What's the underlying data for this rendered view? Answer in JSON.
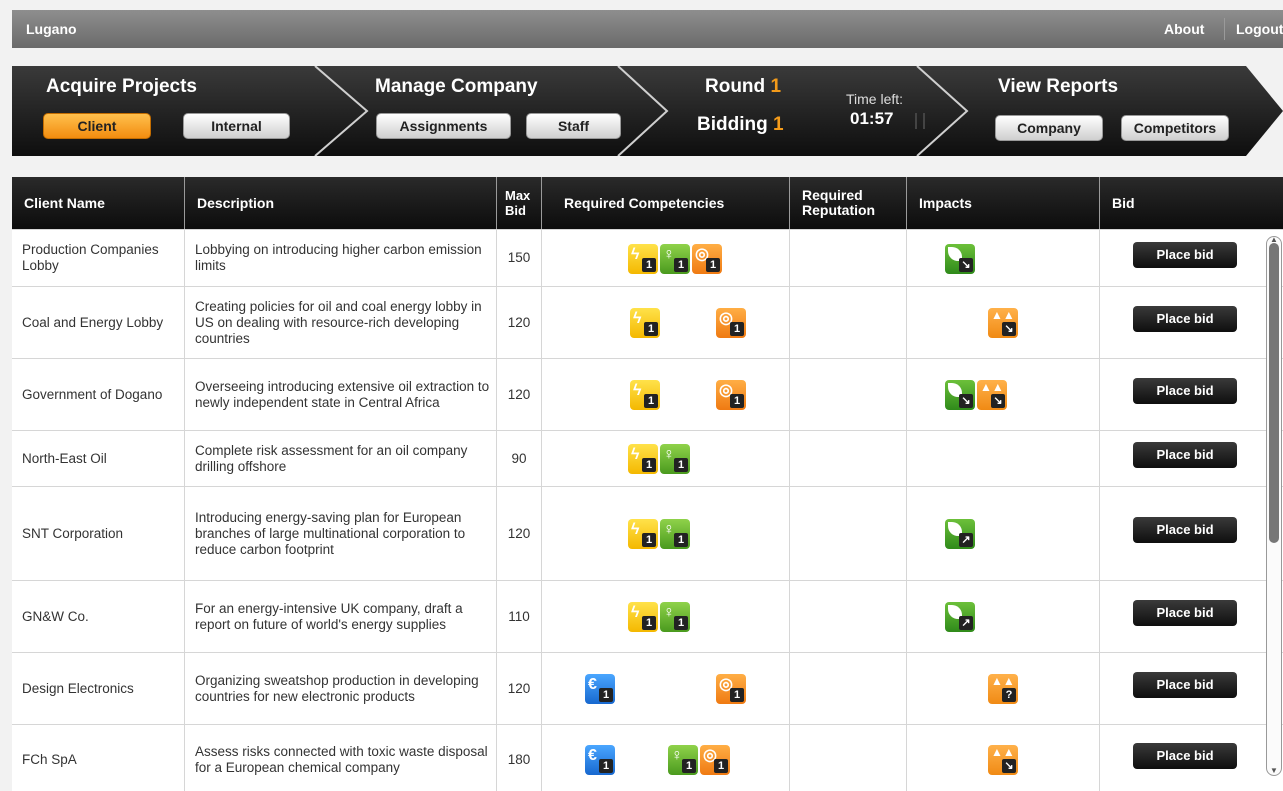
{
  "topbar": {
    "app_title": "Lugano",
    "about": "About",
    "logout": "Logout"
  },
  "nav": {
    "acquire_projects": {
      "title": "Acquire Projects",
      "client": "Client",
      "internal": "Internal"
    },
    "manage_company": {
      "title": "Manage Company",
      "assignments": "Assignments",
      "staff": "Staff"
    },
    "round": {
      "label": "Round",
      "value": "1"
    },
    "bidding": {
      "label": "Bidding",
      "value": "1"
    },
    "timer": {
      "label": "Time left:",
      "value": "01:57"
    },
    "view_reports": {
      "title": "View Reports",
      "company": "Company",
      "competitors": "Competitors"
    },
    "colors": {
      "accent": "#f49b1a",
      "active_button": "#f7a234"
    }
  },
  "table": {
    "headers": {
      "client_name": "Client Name",
      "description": "Description",
      "max_bid": [
        "Max",
        "Bid"
      ],
      "required_competencies": "Required Competencies",
      "required_reputation": [
        "Required",
        "Reputation"
      ],
      "impacts": "Impacts",
      "bid": "Bid"
    },
    "bid_label": "Place bid",
    "rows": [
      {
        "name": "Production Companies Lobby",
        "description": "Lobbying on introducing higher carbon emission limits",
        "max_bid": "150",
        "competencies": [
          {
            "type": "energy-icon",
            "level": "1"
          },
          {
            "type": "idea-icon",
            "level": "1"
          },
          {
            "type": "speech-icon",
            "level": "1"
          }
        ],
        "impacts": [
          {
            "type": "environment-icon",
            "direction": "down"
          }
        ]
      },
      {
        "name": "Coal and Energy Lobby",
        "description": "Creating policies for oil and coal energy lobby in US on dealing with resource-rich developing countries",
        "max_bid": "120",
        "competencies": [
          {
            "type": "energy-icon",
            "level": "1"
          },
          {
            "type": "speech-icon",
            "level": "1"
          }
        ],
        "impacts": [
          {
            "type": "society-icon",
            "direction": "down"
          }
        ]
      },
      {
        "name": "Government of Dogano",
        "description": "Overseeing introducing extensive oil extraction to newly independent state in Central Africa",
        "max_bid": "120",
        "competencies": [
          {
            "type": "energy-icon",
            "level": "1"
          },
          {
            "type": "speech-icon",
            "level": "1"
          }
        ],
        "impacts": [
          {
            "type": "environment-icon",
            "direction": "down"
          },
          {
            "type": "society-icon",
            "direction": "down"
          }
        ]
      },
      {
        "name": "North-East Oil",
        "description": "Complete risk assessment for an oil company drilling offshore",
        "max_bid": "90",
        "competencies": [
          {
            "type": "energy-icon",
            "level": "1"
          },
          {
            "type": "idea-icon",
            "level": "1"
          }
        ],
        "impacts": []
      },
      {
        "name": "SNT Corporation",
        "description": "Introducing energy-saving plan for European branches of large multinational corporation to reduce carbon footprint",
        "max_bid": "120",
        "competencies": [
          {
            "type": "energy-icon",
            "level": "1"
          },
          {
            "type": "idea-icon",
            "level": "1"
          }
        ],
        "impacts": [
          {
            "type": "environment-icon",
            "direction": "up"
          }
        ]
      },
      {
        "name": "GN&W Co.",
        "description": "For an energy-intensive UK company, draft a report on future of world's energy supplies",
        "max_bid": "110",
        "competencies": [
          {
            "type": "energy-icon",
            "level": "1"
          },
          {
            "type": "idea-icon",
            "level": "1"
          }
        ],
        "impacts": [
          {
            "type": "environment-icon",
            "direction": "up"
          }
        ]
      },
      {
        "name": "Design Electronics",
        "description": "Organizing sweatshop production in developing countries for new electronic products",
        "max_bid": "120",
        "competencies": [
          {
            "type": "finance-icon",
            "level": "1"
          },
          {
            "type": "speech-icon",
            "level": "1"
          }
        ],
        "impacts": [
          {
            "type": "society-icon",
            "direction": "unknown"
          }
        ]
      },
      {
        "name": "FCh SpA",
        "description": "Assess risks connected with toxic waste disposal for a European chemical company",
        "max_bid": "180",
        "competencies": [
          {
            "type": "finance-icon",
            "level": "1"
          },
          {
            "type": "idea-icon",
            "level": "1"
          },
          {
            "type": "speech-icon",
            "level": "1"
          }
        ],
        "impacts": [
          {
            "type": "society-icon",
            "direction": "down"
          }
        ]
      }
    ]
  }
}
